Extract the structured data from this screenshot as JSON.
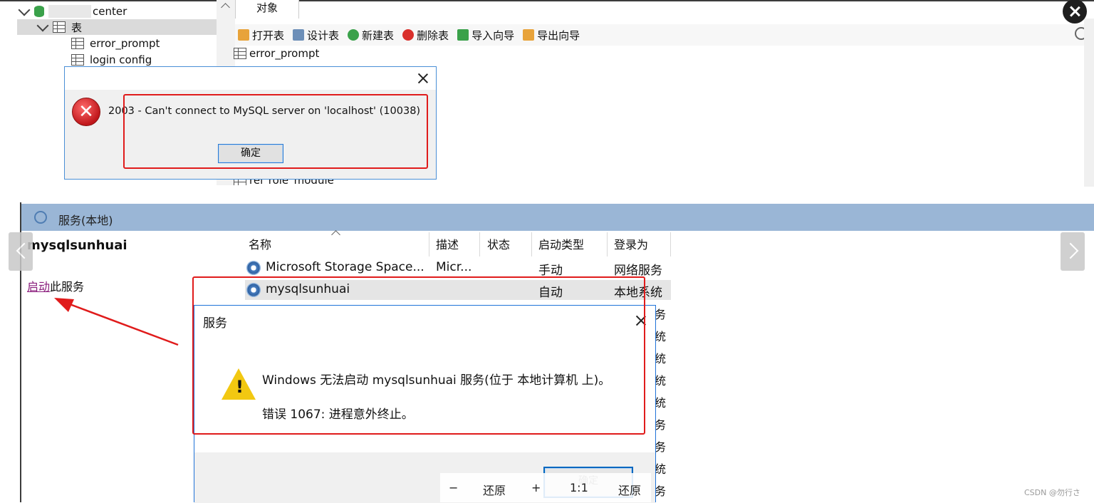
{
  "navicat": {
    "tree": {
      "db_suffix": "center",
      "tables_group": "表",
      "tables": [
        "error_prompt",
        "login config"
      ]
    },
    "tab_objects": "对象",
    "toolbar": [
      {
        "label": "打开表",
        "icon": "open-table-icon",
        "color": "#e8a33a"
      },
      {
        "label": "设计表",
        "icon": "design-table-icon",
        "color": "#6d8fb8"
      },
      {
        "label": "新建表",
        "icon": "new-table-icon",
        "color": "#3aa14a"
      },
      {
        "label": "删除表",
        "icon": "delete-table-icon",
        "color": "#d9302c"
      },
      {
        "label": "导入向导",
        "icon": "import-wizard-icon",
        "color": "#3aa14a"
      },
      {
        "label": "导出向导",
        "icon": "export-wizard-icon",
        "color": "#e8a33a"
      }
    ],
    "object_list": [
      "error_prompt",
      "rel_role_module"
    ]
  },
  "mysql_error": {
    "message": "2003 - Can't connect to MySQL server on 'localhost' (10038)",
    "ok_label": "确定"
  },
  "services": {
    "window_title": "服务(本地)",
    "selected_service": "mysqlsunhuai",
    "start_link": "启动",
    "start_suffix": "此服务",
    "columns": [
      "名称",
      "描述",
      "状态",
      "启动类型",
      "登录为"
    ],
    "rows": [
      {
        "name": "Microsoft Storage Space...",
        "desc": "Micr...",
        "status": "",
        "startup": "手动",
        "logon": "网络服务"
      },
      {
        "name": "mysqlsunhuai",
        "desc": "",
        "status": "",
        "startup": "自动",
        "logon": "本地系统"
      }
    ],
    "right_clip_chars": [
      "务",
      "统",
      "统",
      "统",
      "统",
      "务",
      "务",
      "统",
      "务"
    ]
  },
  "service_error": {
    "title": "服务",
    "message": "Windows 无法启动 mysqlsunhuai 服务(位于 本地计算机 上)。",
    "detail": "错误 1067: 进程意外终止。",
    "ok_label": "确定"
  },
  "viewer": {
    "zoom_out": "−",
    "restore1": "还原",
    "zoom_in": "+",
    "ratio": "1:1",
    "restore2": "还原"
  },
  "watermark": "CSDN @勿行さ",
  "colors": {
    "highlight_red": "#e01b1b",
    "title_blue": "#9ab6d6",
    "link_purple": "#8a1c7c"
  }
}
